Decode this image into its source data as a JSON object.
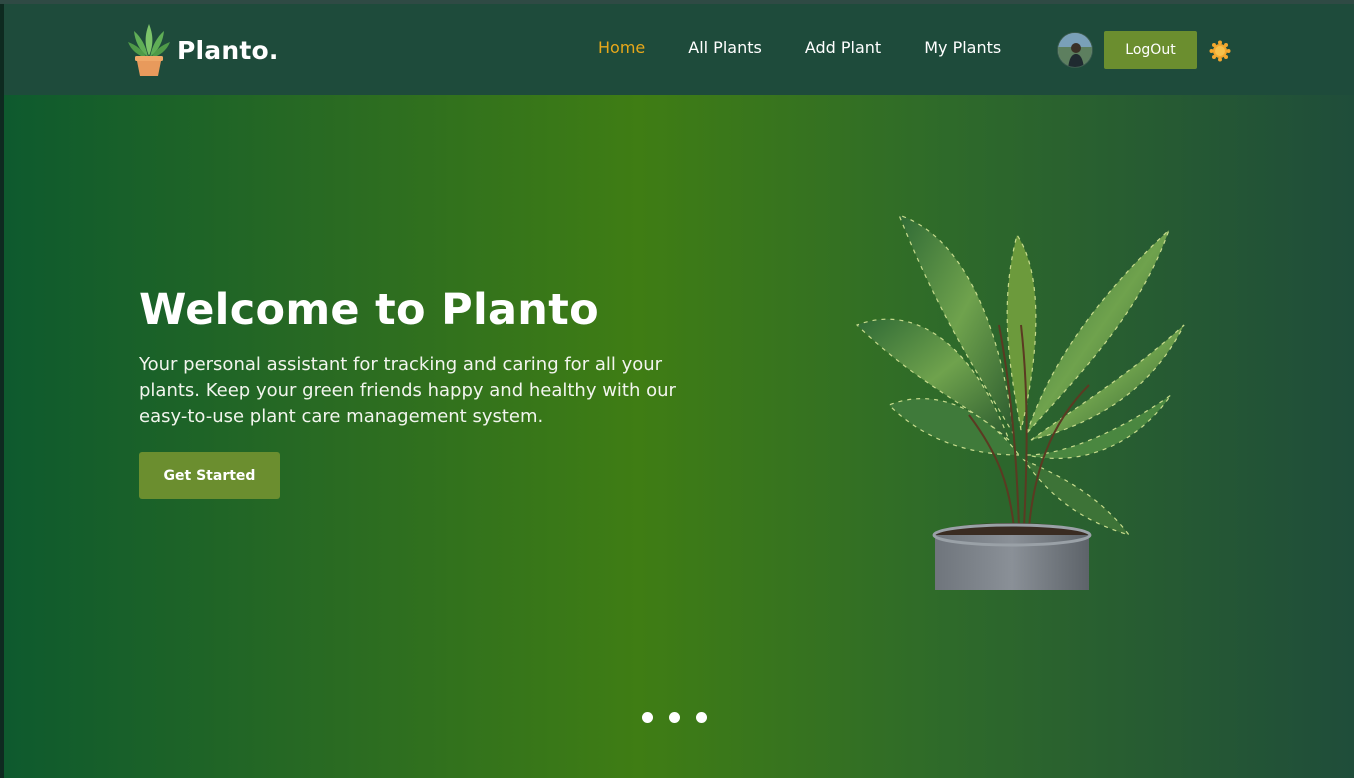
{
  "brand": {
    "name": "Planto.",
    "logo_icon": "potted-plant-logo-icon"
  },
  "nav": {
    "links": [
      {
        "label": "Home",
        "active": true
      },
      {
        "label": "All Plants",
        "active": false
      },
      {
        "label": "Add Plant",
        "active": false
      },
      {
        "label": "My Plants",
        "active": false
      }
    ],
    "logout_label": "LogOut",
    "avatar_icon": "user-avatar",
    "theme_toggle_icon": "sun-icon"
  },
  "hero": {
    "title": "Welcome to Planto",
    "description": "Your personal assistant for tracking and caring for all your plants. Keep your green friends happy and healthy with our easy-to-use plant care management system.",
    "cta_label": "Get Started",
    "image_icon": "potted-calathea-plant-image",
    "slides": {
      "count": 3
    }
  },
  "colors": {
    "accent_active": "#e8a81a",
    "button": "#6b8e2f",
    "navbar": "#1e4b3b",
    "hero_left": "#0e5a2e",
    "hero_mid": "#3f7d14",
    "hero_right": "#1f4d3a"
  }
}
